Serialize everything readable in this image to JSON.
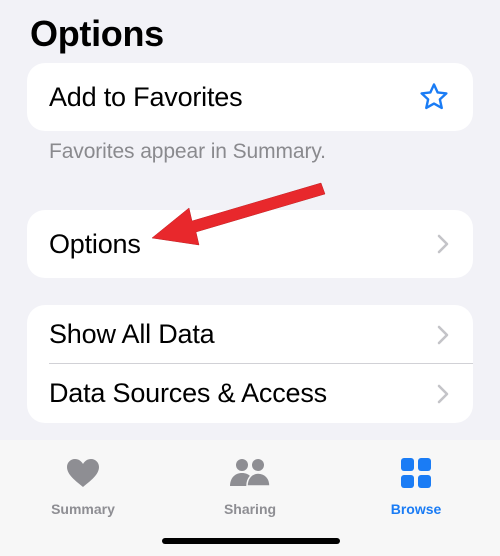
{
  "header": {
    "title": "Options"
  },
  "favorites_card": {
    "label": "Add to Favorites",
    "icon": "star-icon",
    "footer": "Favorites appear in Summary."
  },
  "options_card": {
    "label": "Options",
    "icon": "chevron-right-icon"
  },
  "data_card": {
    "items": [
      {
        "label": "Show All Data",
        "icon": "chevron-right-icon"
      },
      {
        "label": "Data Sources & Access",
        "icon": "chevron-right-icon"
      }
    ]
  },
  "tabbar": {
    "tabs": [
      {
        "label": "Summary",
        "icon": "heart-icon",
        "active": false
      },
      {
        "label": "Sharing",
        "icon": "people-icon",
        "active": false
      },
      {
        "label": "Browse",
        "icon": "grid-icon",
        "active": true
      }
    ]
  },
  "colors": {
    "accent": "#1a7cf5",
    "inactive_tab": "#8e8e93",
    "annotation_arrow": "#e8282c",
    "background": "#f2f2f7"
  }
}
